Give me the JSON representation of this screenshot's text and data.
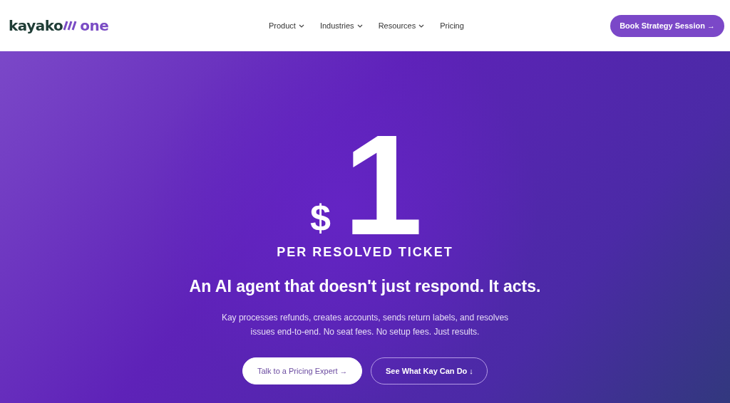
{
  "logo": {
    "name": "kayako",
    "suffix": "one"
  },
  "nav": [
    {
      "label": "Product",
      "dropdown": true
    },
    {
      "label": "Industries",
      "dropdown": true
    },
    {
      "label": "Resources",
      "dropdown": true
    },
    {
      "label": "Pricing",
      "dropdown": false
    }
  ],
  "header_button": "Book Strategy Session →",
  "hero": {
    "currency": "$",
    "price": "1",
    "unit": "PER RESOLVED TICKET",
    "headline": "An AI agent that doesn't just respond. It acts.",
    "description": "Kay processes refunds, creates accounts, sends return labels, and resolves issues end-to-end. No seat fees. No setup fees. Just results.",
    "buttons": [
      {
        "label": "Talk to a Pricing Expert →",
        "kind": "primary"
      },
      {
        "label": "See What Kay Can Do ↓",
        "kind": "outline"
      }
    ]
  }
}
